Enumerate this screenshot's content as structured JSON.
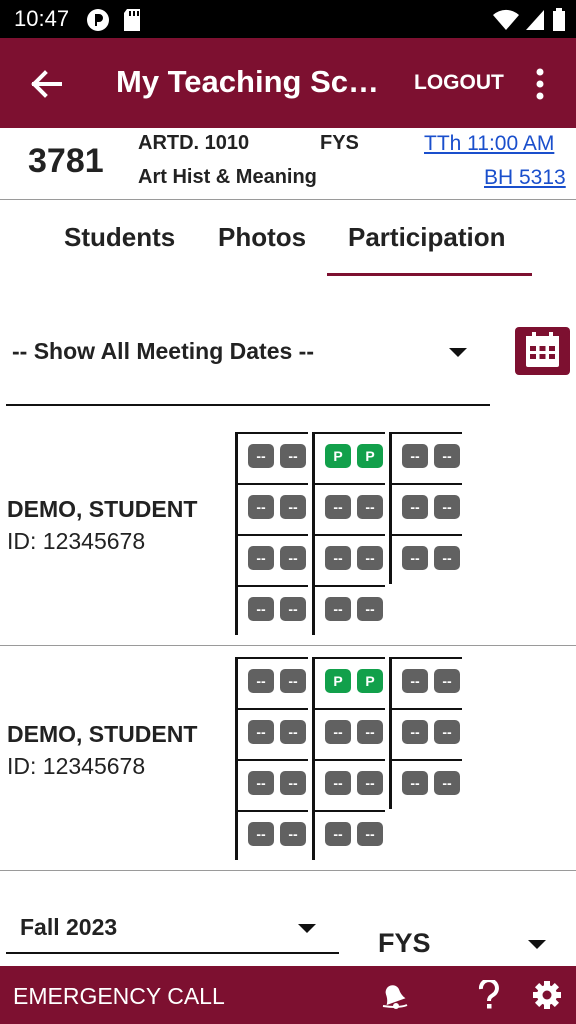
{
  "status_bar": {
    "time": "10:47"
  },
  "app_bar": {
    "title": "My Teaching Sch...",
    "logout_label": "LOGOUT"
  },
  "course": {
    "number": "3781",
    "code": "ARTD. 1010",
    "name": "Art Hist & Meaning",
    "type": "FYS",
    "time_link": "TTh  11:00 AM",
    "room_link": "BH 5313"
  },
  "tabs": [
    {
      "label": "Students",
      "active": false
    },
    {
      "label": "Photos",
      "active": false
    },
    {
      "label": "Participation",
      "active": true
    }
  ],
  "date_filter": {
    "label": "-- Show All Meeting Dates --"
  },
  "students": [
    {
      "name": "DEMO, STUDENT",
      "id_label": "ID: 12345678",
      "attendance": [
        [
          [
            "--",
            "--"
          ],
          [
            "P",
            "P"
          ],
          [
            "--",
            "--"
          ]
        ],
        [
          [
            "--",
            "--"
          ],
          [
            "--",
            "--"
          ],
          [
            "--",
            "--"
          ]
        ],
        [
          [
            "--",
            "--"
          ],
          [
            "--",
            "--"
          ],
          [
            "--",
            "--"
          ]
        ],
        [
          [
            "--",
            "--"
          ],
          [
            "--",
            "--"
          ]
        ]
      ]
    },
    {
      "name": "DEMO, STUDENT",
      "id_label": "ID: 12345678",
      "attendance": [
        [
          [
            "--",
            "--"
          ],
          [
            "P",
            "P"
          ],
          [
            "--",
            "--"
          ]
        ],
        [
          [
            "--",
            "--"
          ],
          [
            "--",
            "--"
          ],
          [
            "--",
            "--"
          ]
        ],
        [
          [
            "--",
            "--"
          ],
          [
            "--",
            "--"
          ],
          [
            "--",
            "--"
          ]
        ],
        [
          [
            "--",
            "--"
          ],
          [
            "--",
            "--"
          ]
        ]
      ]
    }
  ],
  "term_filter": {
    "label": "Fall 2023"
  },
  "type_filter": {
    "label": "FYS"
  },
  "bottom_bar": {
    "emergency_label": "EMERGENCY CALL"
  },
  "colors": {
    "brand": "#7d1030",
    "present_chip": "#12a04b",
    "empty_chip": "#616161",
    "link": "#1a4fcc"
  }
}
